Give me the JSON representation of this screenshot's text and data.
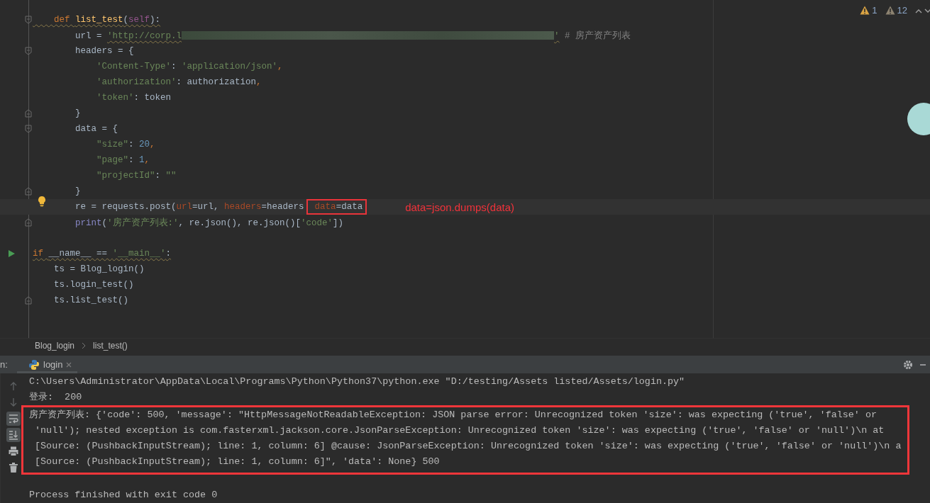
{
  "editor": {
    "inspections": [
      {
        "kind": "error",
        "count": "1"
      },
      {
        "kind": "weak",
        "count": "12"
      }
    ],
    "lines": [
      {
        "gutter": {
          "kind": "fold-start"
        },
        "current": false,
        "tokens": [
          {
            "text": "    def ",
            "kind": "kw",
            "warn": true
          },
          {
            "text": "list_test",
            "kind": "fn",
            "warn": true
          },
          {
            "text": "(",
            "kind": "plain",
            "warn": true
          },
          {
            "text": "self",
            "kind": "self",
            "warn": true
          },
          {
            "text": "):",
            "kind": "plain",
            "warn": true
          }
        ]
      },
      {
        "current": false,
        "tokens": [
          {
            "text": "        url = ",
            "kind": "plain"
          },
          {
            "text": "'http://corp.l",
            "kind": "str",
            "warn": true
          },
          {
            "kind": "blur",
            "warn": true
          },
          {
            "text": "'",
            "kind": "str",
            "warn": true
          },
          {
            "text": " # 房产资产列表",
            "kind": "comment"
          }
        ]
      },
      {
        "gutter": {
          "kind": "fold-start"
        },
        "current": false,
        "tokens": [
          {
            "text": "        headers = {",
            "kind": "plain"
          }
        ]
      },
      {
        "current": false,
        "tokens": [
          {
            "text": "            'Content-Type'",
            "kind": "str"
          },
          {
            "text": ": ",
            "kind": "plain"
          },
          {
            "text": "'application/json'",
            "kind": "str"
          },
          {
            "text": ",",
            "kind": "kw"
          }
        ]
      },
      {
        "current": false,
        "tokens": [
          {
            "text": "            'authorization'",
            "kind": "str"
          },
          {
            "text": ": authorization",
            "kind": "plain"
          },
          {
            "text": ",",
            "kind": "kw"
          }
        ]
      },
      {
        "current": false,
        "tokens": [
          {
            "text": "            'token'",
            "kind": "str"
          },
          {
            "text": ": token",
            "kind": "plain"
          }
        ]
      },
      {
        "gutter": {
          "kind": "fold-end"
        },
        "current": false,
        "tokens": [
          {
            "text": "        }",
            "kind": "plain"
          }
        ]
      },
      {
        "gutter": {
          "kind": "fold-start"
        },
        "current": false,
        "tokens": [
          {
            "text": "        data = {",
            "kind": "plain"
          }
        ]
      },
      {
        "current": false,
        "tokens": [
          {
            "text": "            \"size\"",
            "kind": "str"
          },
          {
            "text": ": ",
            "kind": "plain"
          },
          {
            "text": "20",
            "kind": "num"
          },
          {
            "text": ",",
            "kind": "kw"
          }
        ]
      },
      {
        "current": false,
        "tokens": [
          {
            "text": "            \"page\"",
            "kind": "str"
          },
          {
            "text": ": ",
            "kind": "plain"
          },
          {
            "text": "1",
            "kind": "num"
          },
          {
            "text": ",",
            "kind": "kw"
          }
        ]
      },
      {
        "current": false,
        "tokens": [
          {
            "text": "            \"projectId\"",
            "kind": "str"
          },
          {
            "text": ": ",
            "kind": "plain"
          },
          {
            "text": "\"\"",
            "kind": "str"
          }
        ]
      },
      {
        "gutter": {
          "kind": "fold-end"
        },
        "current": false,
        "tokens": [
          {
            "text": "        }",
            "kind": "plain"
          }
        ]
      },
      {
        "gutter": {
          "kind": "bulb"
        },
        "current": true,
        "note": "data=json.dumps(data)",
        "tokens": [
          {
            "text": "        re = requests.post(",
            "kind": "plain"
          },
          {
            "text": "url",
            "kind": "param"
          },
          {
            "text": "=url, ",
            "kind": "plain"
          },
          {
            "text": "headers",
            "kind": "param"
          },
          {
            "text": "=headers  ",
            "kind": "plain"
          },
          {
            "text": "data",
            "kind": "param",
            "boxed": true
          },
          {
            "text": "=data",
            "kind": "plain",
            "boxed": true
          }
        ]
      },
      {
        "gutter": {
          "kind": "fold-end"
        },
        "current": false,
        "tokens": [
          {
            "text": "        print",
            "kind": "builtin"
          },
          {
            "text": "(",
            "kind": "plain"
          },
          {
            "text": "'房产资产列表:'",
            "kind": "str"
          },
          {
            "text": ", re.json(), re.json()[",
            "kind": "plain"
          },
          {
            "text": "'code'",
            "kind": "str"
          },
          {
            "text": "])",
            "kind": "plain"
          }
        ]
      },
      {
        "current": false
      },
      {
        "gutter": {
          "kind": "run"
        },
        "current": false,
        "tokens": [
          {
            "text": "if ",
            "kind": "kw",
            "warn": true
          },
          {
            "text": "__name__ == ",
            "kind": "plain",
            "warn": true
          },
          {
            "text": "'__main__'",
            "kind": "str",
            "warn": true
          },
          {
            "text": ":",
            "kind": "plain",
            "warn": true
          }
        ]
      },
      {
        "current": false,
        "tokens": [
          {
            "text": "    ts = Blog_login()",
            "kind": "plain"
          }
        ]
      },
      {
        "current": false,
        "tokens": [
          {
            "text": "    ts.login_test()",
            "kind": "plain"
          }
        ]
      },
      {
        "gutter": {
          "kind": "fold-end"
        },
        "current": false,
        "tokens": [
          {
            "text": "    ts.list_test()",
            "kind": "plain"
          }
        ]
      }
    ]
  },
  "breadcrumbs": [
    "Blog_login",
    "list_test()"
  ],
  "run_panel": {
    "label": "n:",
    "tabs": [
      {
        "label": "login",
        "selected": true
      }
    ],
    "tools": [
      {
        "kind": "up",
        "on": false
      },
      {
        "kind": "down",
        "on": false
      },
      {
        "kind": "wrap",
        "on": true
      },
      {
        "kind": "scroll-end",
        "on": true
      },
      {
        "kind": "print",
        "on": false
      },
      {
        "kind": "trash",
        "on": false
      }
    ],
    "console": [
      "C:\\Users\\Administrator\\AppData\\Local\\Programs\\Python\\Python37\\python.exe \"D:/testing/Assets listed/Assets/login.py\"",
      "登录:  200"
    ],
    "error_box": [
      "房产资产列表: {'code': 500, 'message': \"HttpMessageNotReadableException: JSON parse error: Unrecognized token 'size': was expecting ('true', 'false' or",
      " 'null'); nested exception is com.fasterxml.jackson.core.JsonParseException: Unrecognized token 'size': was expecting ('true', 'false' or 'null')\\n at",
      " [Source: (PushbackInputStream); line: 1, column: 6] @cause: JsonParseException: Unrecognized token 'size': was expecting ('true', 'false' or 'null')\\n a",
      " [Source: (PushbackInputStream); line: 1, column: 6]\", 'data': None} 500"
    ],
    "exit_line": "Process finished with exit code 0"
  }
}
